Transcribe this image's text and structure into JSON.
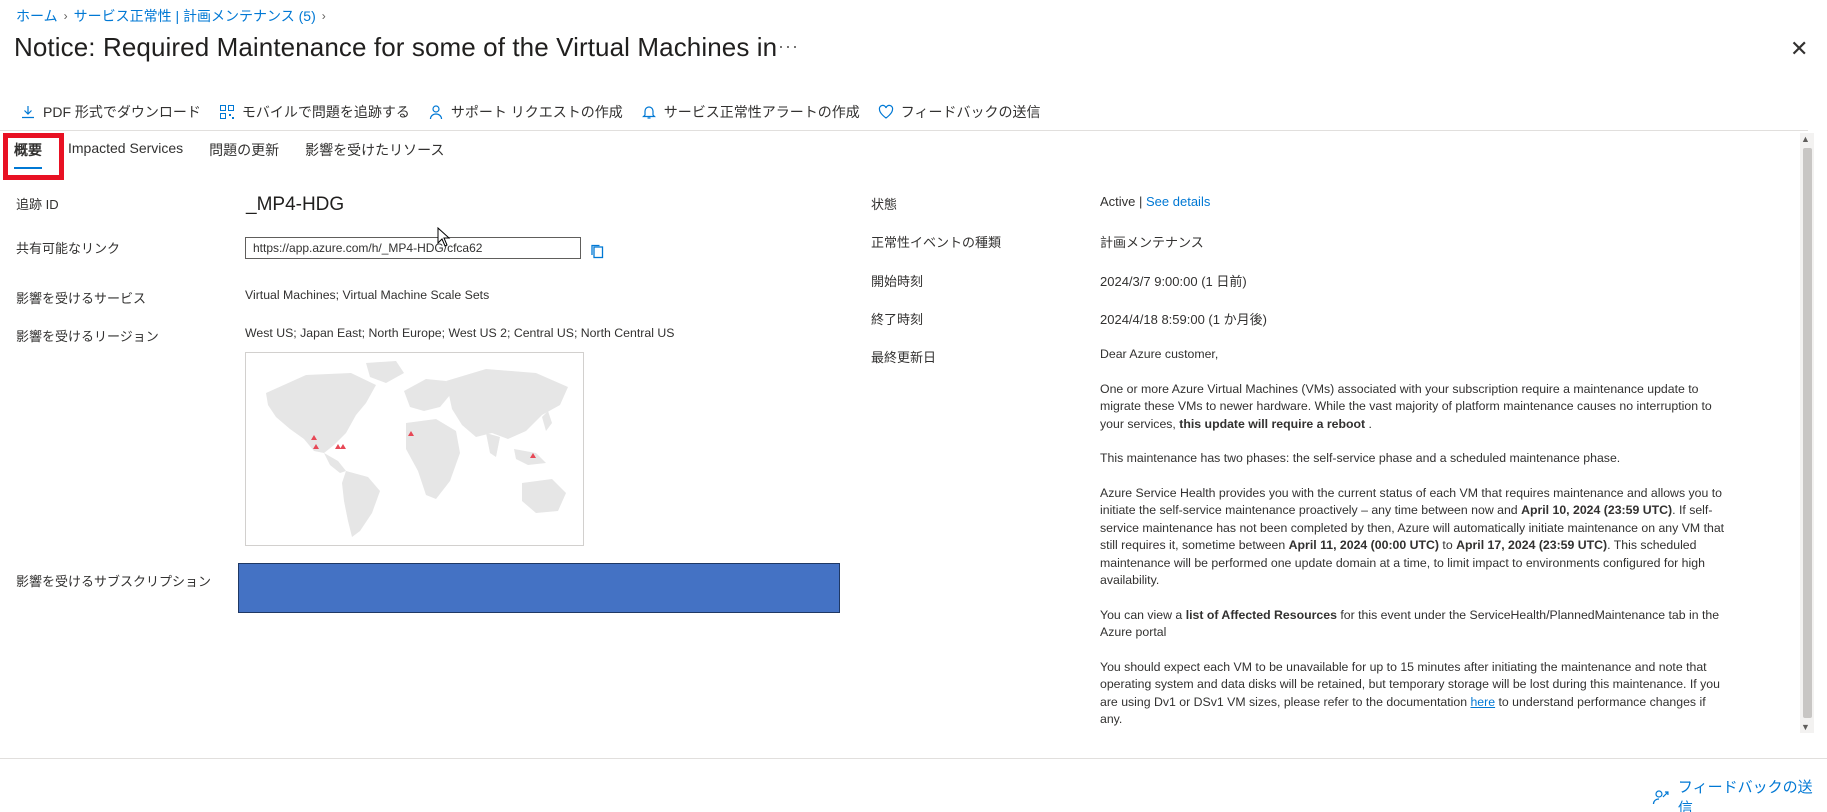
{
  "breadcrumb": {
    "home": "ホーム",
    "section": "サービス正常性 | 計画メンテナンス (5)"
  },
  "title": "Notice: Required Maintenance for some of the Virtual Machines in",
  "more": "···",
  "toolbar": {
    "download": "PDF 形式でダウンロード",
    "mobile": "モバイルで問題を追跡する",
    "support": "サポート リクエストの作成",
    "alert": "サービス正常性アラートの作成",
    "feedback": "フィードバックの送信"
  },
  "tabs": {
    "overview": "概要",
    "impacted": "Impacted Services",
    "updates": "問題の更新",
    "resources": "影響を受けたリソース"
  },
  "left": {
    "tracking_label": "追跡 ID",
    "tracking_value": "_MP4-HDG",
    "link_label": "共有可能なリンク",
    "link_value": "https://app.azure.com/h/_MP4-HDG/cfca62",
    "services_label": "影響を受けるサービス",
    "services_value": "Virtual Machines; Virtual Machine Scale Sets",
    "regions_label": "影響を受けるリージョン",
    "regions_value": "West US; Japan East; North Europe; West US 2; Central US; North Central US",
    "subscription_label": "影響を受けるサブスクリプション"
  },
  "right": {
    "status_label": "状態",
    "status_value": "Active",
    "status_sep": " | ",
    "status_link": "See details",
    "event_type_label": "正常性イベントの種類",
    "event_type_value": "計画メンテナンス",
    "start_label": "開始時刻",
    "start_value": "2024/3/7 9:00:00 (1 日前)",
    "end_label": "終了時刻",
    "end_value": "2024/4/18 8:59:00 (1 か月後)",
    "updated_label": "最終更新日"
  },
  "description": {
    "greeting": "Dear Azure customer,",
    "p1a": "One or more Azure Virtual Machines (VMs) associated with your subscription require a maintenance update to migrate these VMs to newer hardware. While the vast majority of platform maintenance causes no interruption to your services, ",
    "p1b": "this update will require a reboot",
    "p1c": " .",
    "p2": "This maintenance has two phases: the self-service phase and a scheduled maintenance phase.",
    "p3a": "Azure Service Health provides you with the current status of each VM that requires maintenance and allows you to initiate the self-service maintenance proactively – any time between now and ",
    "p3b": "April 10, 2024 (23:59 UTC)",
    "p3c": ". If self-service maintenance has not been completed by then, Azure will automatically initiate maintenance on any VM that still requires it, sometime between ",
    "p3d": "April 11, 2024 (00:00 UTC)",
    "p3e": " to ",
    "p3f": "April 17, 2024 (23:59 UTC)",
    "p3g": ". This scheduled maintenance will be performed one update domain at a time, to limit impact to environments configured for high availability.",
    "p4a": "You can view a ",
    "p4b": "list of Affected Resources",
    "p4c": " for this event under the ServiceHealth/PlannedMaintenance tab in the Azure portal",
    "p5a": "You should expect each VM to be unavailable for up to 15 minutes after initiating the maintenance and note that operating system and data disks will be retained, but temporary storage will be lost during this maintenance. If you are using Dv1 or DSv1 VM sizes, please refer to the documentation ",
    "p5b": "here",
    "p5c": " to understand performance changes if any."
  },
  "footer": {
    "feedback": "フィードバックの送信"
  },
  "colors": {
    "accent": "#0078d4",
    "highlight": "#e81123",
    "redacted": "#4472c4"
  }
}
